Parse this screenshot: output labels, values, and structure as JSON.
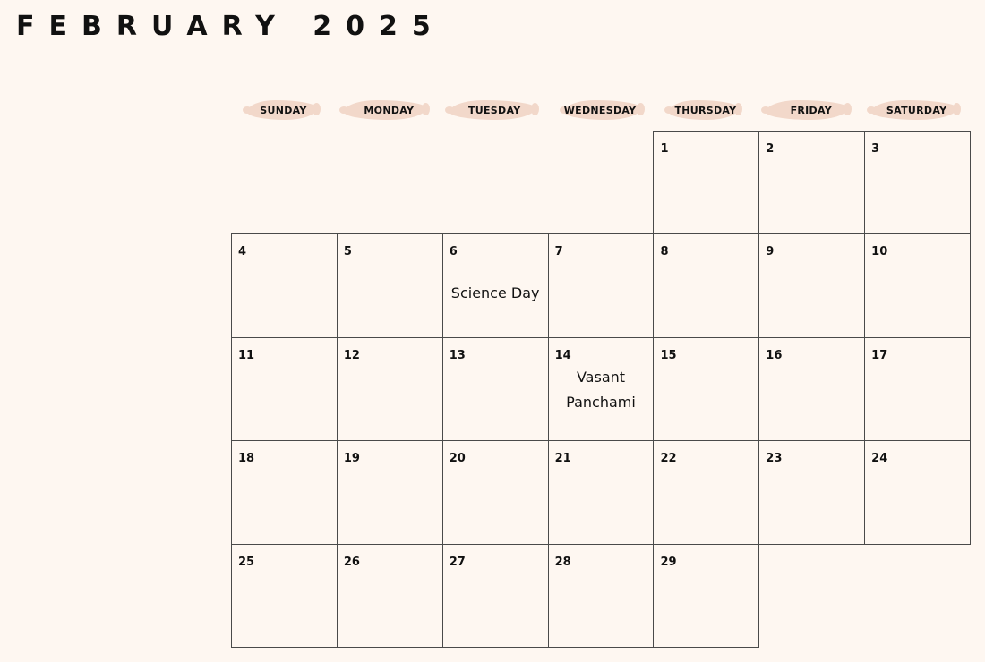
{
  "calendar": {
    "title": "FEBRUARY 2025",
    "weekdays": [
      "SUNDAY",
      "MONDAY",
      "TUESDAY",
      "WEDNESDAY",
      "THURSDAY",
      "FRIDAY",
      "SATURDAY"
    ],
    "days": [
      {
        "date": "1",
        "weekday_index": 4,
        "week": 0
      },
      {
        "date": "2",
        "weekday_index": 5,
        "week": 0
      },
      {
        "date": "3",
        "weekday_index": 6,
        "week": 0
      },
      {
        "date": "4",
        "weekday_index": 0,
        "week": 1
      },
      {
        "date": "5",
        "weekday_index": 1,
        "week": 1
      },
      {
        "date": "6",
        "weekday_index": 2,
        "week": 1,
        "event": "Science Day"
      },
      {
        "date": "7",
        "weekday_index": 3,
        "week": 1
      },
      {
        "date": "8",
        "weekday_index": 4,
        "week": 1
      },
      {
        "date": "9",
        "weekday_index": 5,
        "week": 1
      },
      {
        "date": "10",
        "weekday_index": 6,
        "week": 1
      },
      {
        "date": "11",
        "weekday_index": 0,
        "week": 2
      },
      {
        "date": "12",
        "weekday_index": 1,
        "week": 2
      },
      {
        "date": "13",
        "weekday_index": 2,
        "week": 2
      },
      {
        "date": "14",
        "weekday_index": 3,
        "week": 2,
        "event": "Vasant Panchami"
      },
      {
        "date": "15",
        "weekday_index": 4,
        "week": 2
      },
      {
        "date": "16",
        "weekday_index": 5,
        "week": 2
      },
      {
        "date": "17",
        "weekday_index": 6,
        "week": 2
      },
      {
        "date": "18",
        "weekday_index": 0,
        "week": 3
      },
      {
        "date": "19",
        "weekday_index": 1,
        "week": 3
      },
      {
        "date": "20",
        "weekday_index": 2,
        "week": 3
      },
      {
        "date": "21",
        "weekday_index": 3,
        "week": 3
      },
      {
        "date": "22",
        "weekday_index": 4,
        "week": 3
      },
      {
        "date": "23",
        "weekday_index": 5,
        "week": 3
      },
      {
        "date": "24",
        "weekday_index": 6,
        "week": 3
      },
      {
        "date": "25",
        "weekday_index": 0,
        "week": 4
      },
      {
        "date": "26",
        "weekday_index": 1,
        "week": 4
      },
      {
        "date": "27",
        "weekday_index": 2,
        "week": 4
      },
      {
        "date": "28",
        "weekday_index": 3,
        "week": 4
      },
      {
        "date": "29",
        "weekday_index": 4,
        "week": 4
      }
    ]
  },
  "colors": {
    "background": "#fef7f1",
    "header_brush": "#f2d8ca",
    "grid_line": "#4a4a4a",
    "text": "#111111"
  }
}
